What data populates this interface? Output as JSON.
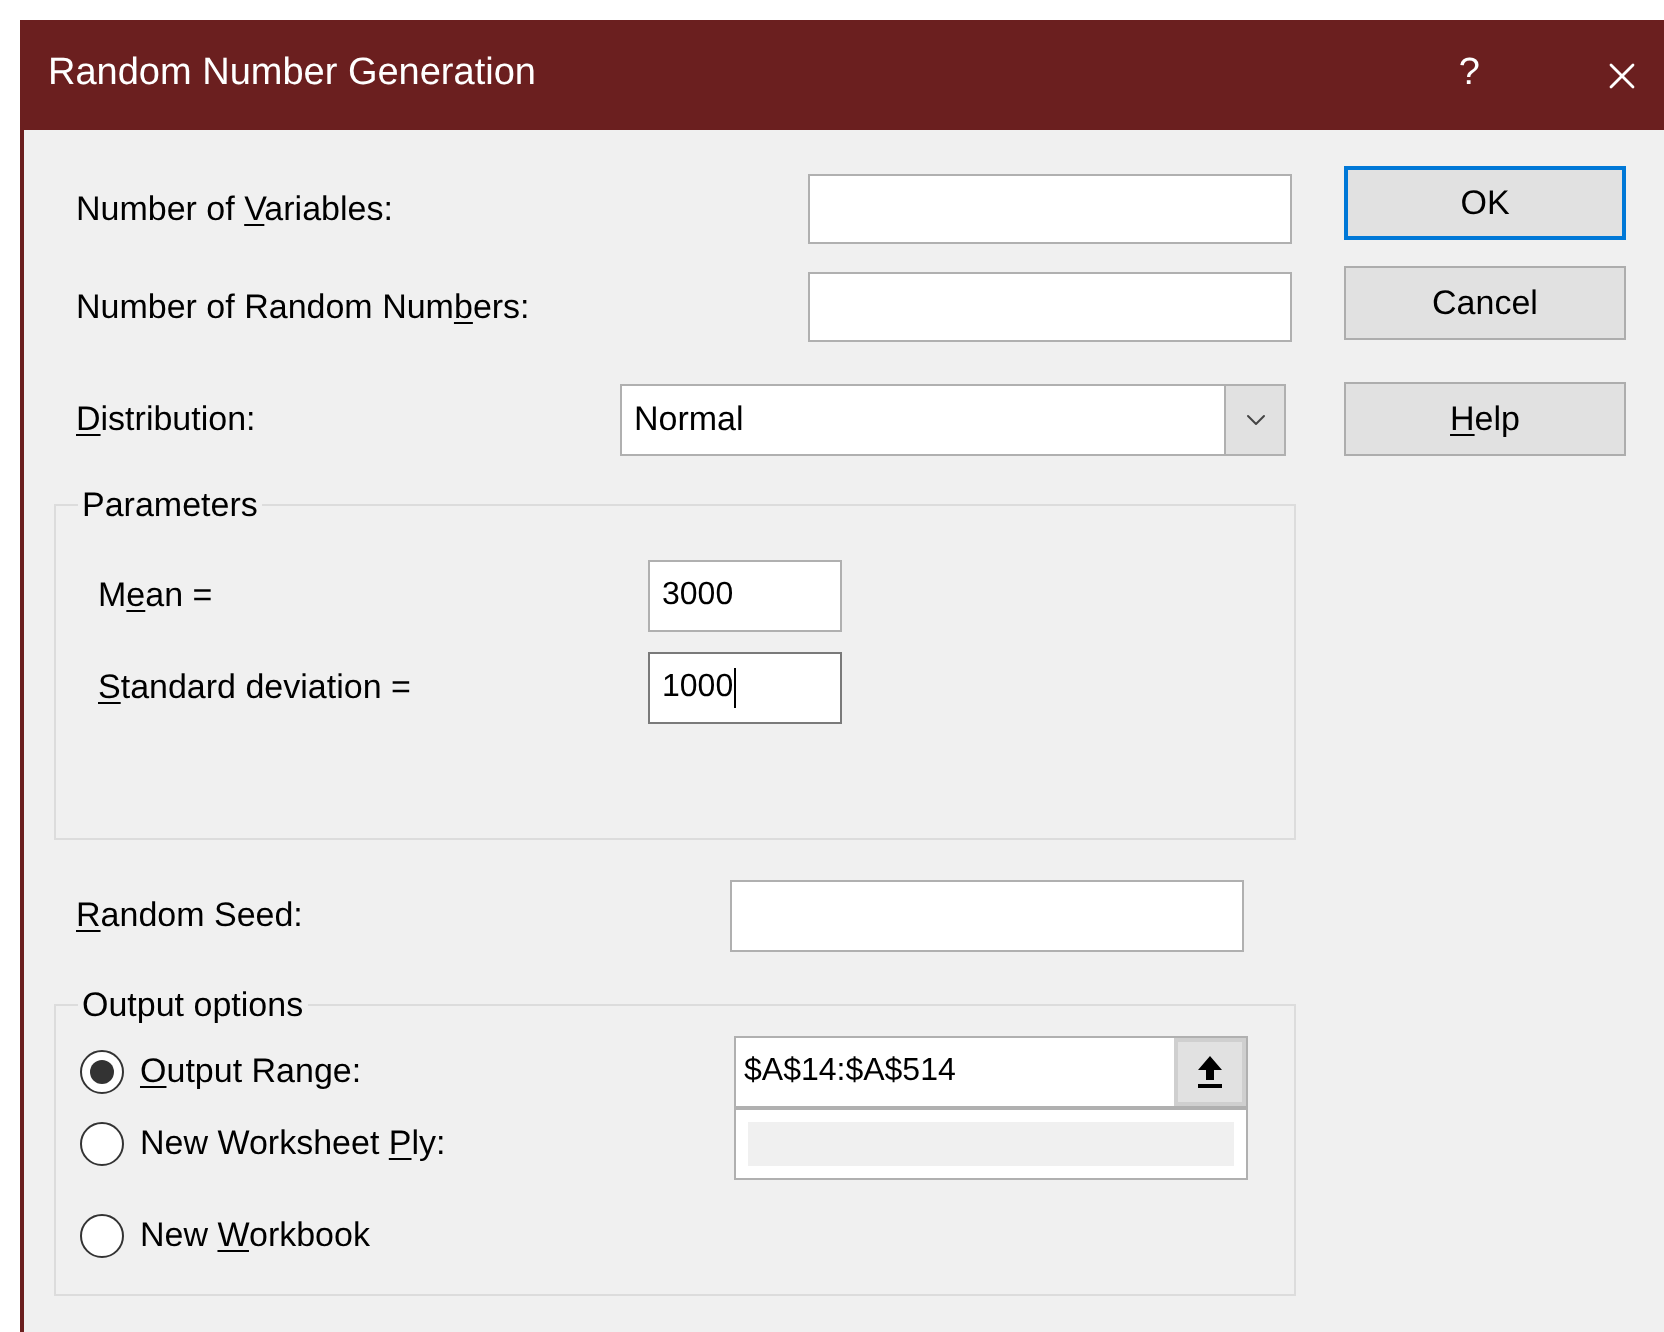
{
  "window": {
    "title": "Random Number Generation",
    "help_glyph": "?"
  },
  "inputs": [
    {
      "label": {
        "pre": "Number of ",
        "key": "V",
        "post": "ariables:"
      }
    },
    {
      "label": {
        "pre": "Number of Random Num",
        "key": "b",
        "post": "ers:"
      }
    }
  ],
  "distribution": {
    "label": {
      "key": "D",
      "post": "istribution:"
    },
    "value": "Normal"
  },
  "parameters": {
    "title": "Parameters",
    "fields": [
      {
        "label": {
          "pre": "M",
          "key": "e",
          "post": "an ="
        },
        "value": "3000",
        "focused": false
      },
      {
        "label": {
          "key": "S",
          "post": "tandard deviation ="
        },
        "value": "1000",
        "focused": true
      }
    ]
  },
  "random_seed": {
    "label": {
      "key": "R",
      "post": "andom Seed:"
    }
  },
  "output_options": {
    "title": "Output options",
    "options": [
      {
        "label": {
          "key": "O",
          "post": "utput Range:"
        },
        "selected": true,
        "kind": "range",
        "value": "$A$14:$A$514"
      },
      {
        "label": {
          "pre": "New Worksheet ",
          "key": "P",
          "post": "ly:"
        },
        "selected": false,
        "kind": "text",
        "disabled": true
      },
      {
        "label": {
          "pre": "New ",
          "key": "W",
          "post": "orkbook"
        },
        "selected": false,
        "kind": "none"
      }
    ]
  },
  "buttons": [
    {
      "label": {
        "pre": "OK"
      },
      "default": true
    },
    {
      "label": {
        "pre": "Cancel"
      },
      "default": false
    },
    {
      "label": {
        "key": "H",
        "post": "elp"
      },
      "default": false
    }
  ]
}
